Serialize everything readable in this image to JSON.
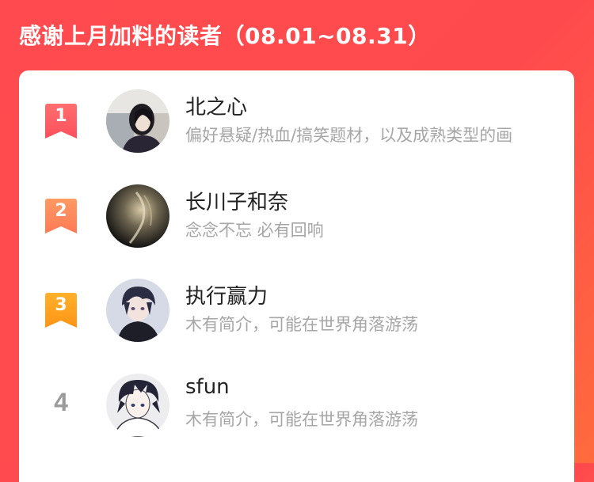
{
  "header": {
    "title": "感谢上月加料的读者（08.01~08.31）"
  },
  "colors": {
    "background": "#ff4b4f",
    "rank1": "#ff5d62",
    "rank2": "#ff8a5c",
    "rank3": "#ffa21f",
    "rank_plain": "#9b9b9b",
    "name": "#222222",
    "desc": "#a6a6a6"
  },
  "readers": [
    {
      "rank": "1",
      "name": "北之心",
      "desc": "偏好悬疑/热血/搞笑题材，以及成熟类型的画",
      "avatar": "avatar-photo-woman"
    },
    {
      "rank": "2",
      "name": "长川子和奈",
      "desc": "念念不忘 必有回响",
      "avatar": "avatar-dark-photo"
    },
    {
      "rank": "3",
      "name": "执行赢力",
      "desc": "木有简介，可能在世界角落游荡",
      "avatar": "avatar-anime-boy"
    },
    {
      "rank": "4",
      "name": "sfun",
      "desc": "木有简介，可能在世界角落游荡",
      "avatar": "avatar-anime-boy-sketch"
    }
  ]
}
